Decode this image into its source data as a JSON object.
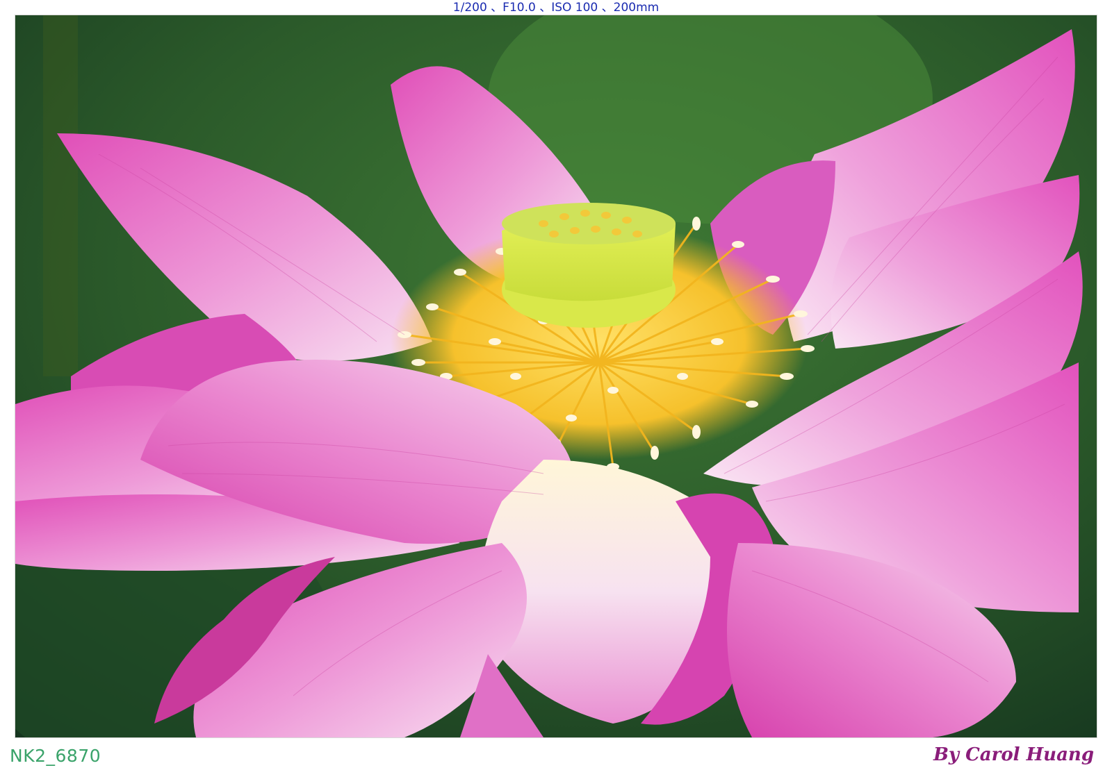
{
  "exif_line": "1/200 、F10.0 、ISO 100 、200mm",
  "photo_label": "NK2_6870",
  "photographer_credit": "By Carol Huang",
  "colors": {
    "background_green": "#2a5a2c",
    "petal_pink": "#e06cc6",
    "petal_light": "#f6d4ee",
    "stamen_yellow": "#f4c430",
    "receptacle_green": "#d8ec48",
    "exif_text": "#1a2bb0",
    "label_text": "#3aa36a",
    "credit_text": "#8a1d7a"
  }
}
